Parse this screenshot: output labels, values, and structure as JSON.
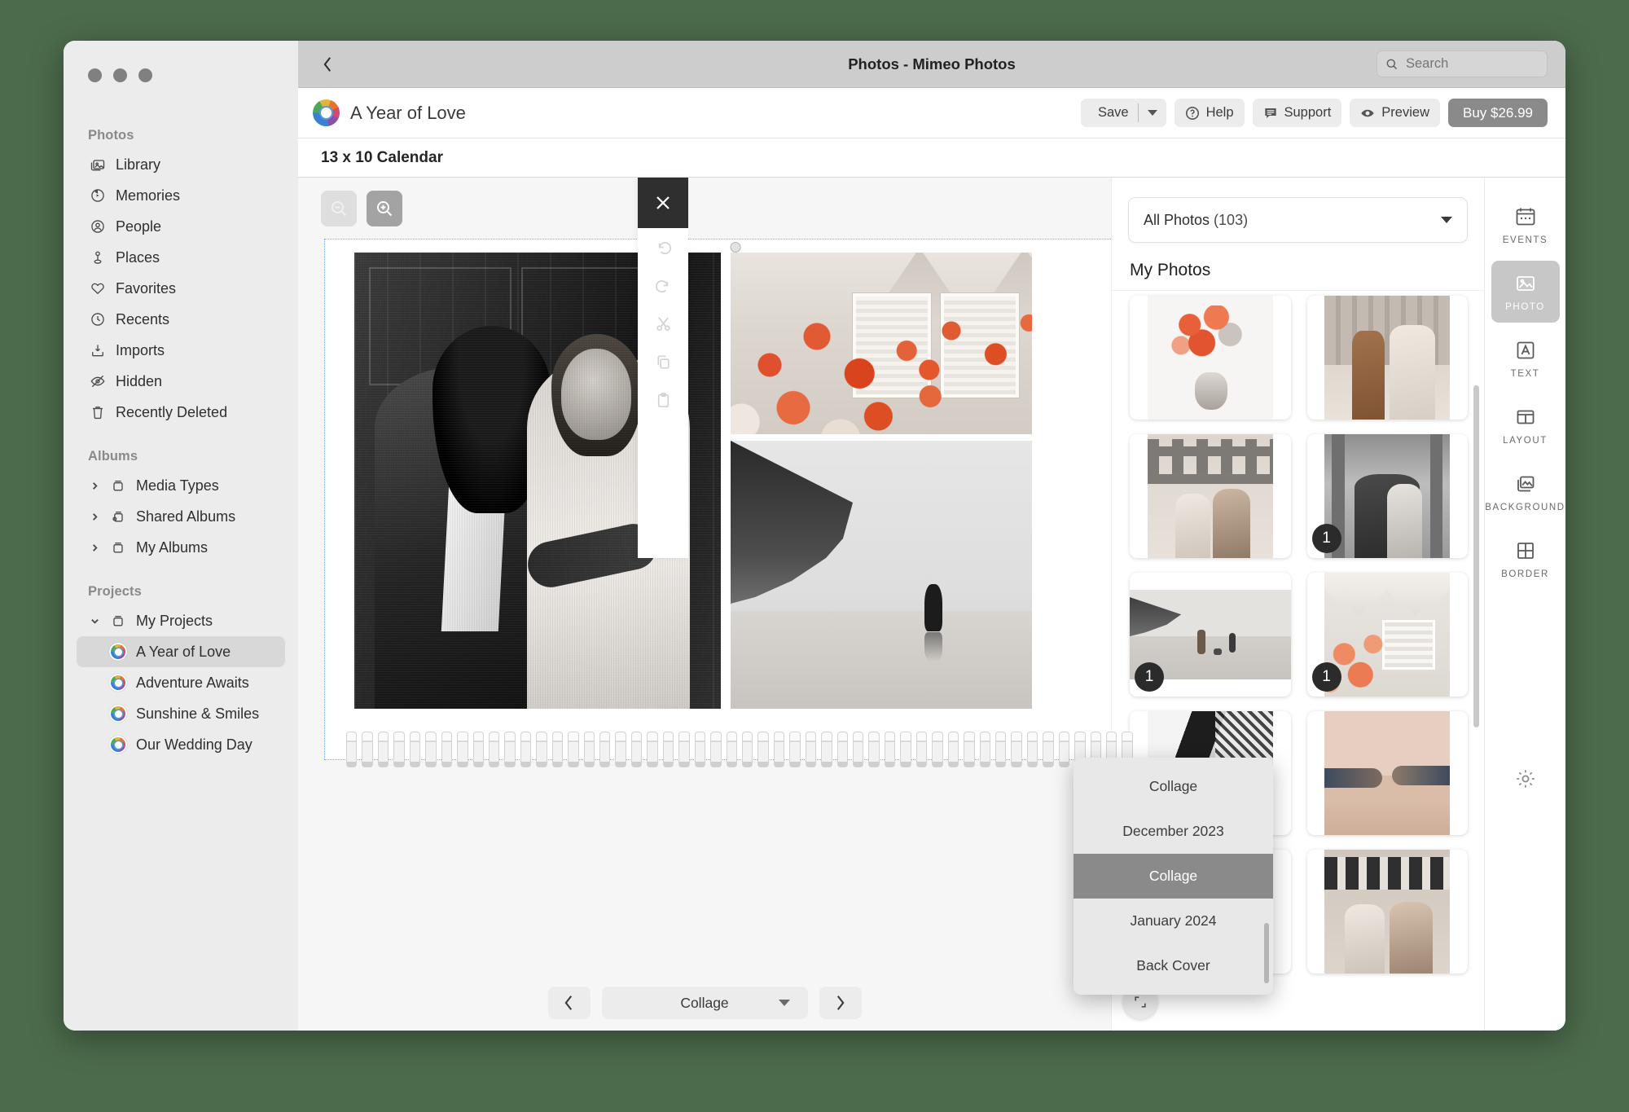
{
  "window": {
    "title": "Photos - Mimeo Photos",
    "back_icon": "chevron-left-icon",
    "search_placeholder": "Search",
    "search_icon": "search-icon"
  },
  "sidebar": {
    "sections": [
      {
        "title": "Photos",
        "items": [
          {
            "label": "Library",
            "icon": "library-icon"
          },
          {
            "label": "Memories",
            "icon": "memories-icon"
          },
          {
            "label": "People",
            "icon": "people-icon"
          },
          {
            "label": "Places",
            "icon": "places-pin-icon"
          },
          {
            "label": "Favorites",
            "icon": "heart-icon"
          },
          {
            "label": "Recents",
            "icon": "clock-icon"
          },
          {
            "label": "Imports",
            "icon": "import-icon"
          },
          {
            "label": "Hidden",
            "icon": "eye-slash-icon"
          },
          {
            "label": "Recently Deleted",
            "icon": "trash-icon"
          }
        ]
      },
      {
        "title": "Albums",
        "items": [
          {
            "label": "Media Types",
            "icon": "album-icon",
            "twisty": "collapsed"
          },
          {
            "label": "Shared Albums",
            "icon": "shared-album-icon",
            "twisty": "collapsed"
          },
          {
            "label": "My Albums",
            "icon": "album-icon",
            "twisty": "collapsed"
          }
        ]
      },
      {
        "title": "Projects",
        "items": [
          {
            "label": "My Projects",
            "icon": "album-icon",
            "twisty": "expanded"
          },
          {
            "label": "A Year of Love",
            "icon": "project-icon",
            "selected": true,
            "indent": true
          },
          {
            "label": "Adventure Awaits",
            "icon": "project-icon",
            "indent": true
          },
          {
            "label": "Sunshine & Smiles",
            "icon": "project-icon",
            "indent": true
          },
          {
            "label": "Our Wedding Day",
            "icon": "project-icon",
            "indent": true
          }
        ]
      }
    ]
  },
  "toolbar": {
    "project_name": "A Year of Love",
    "logo_icon": "mimeo-logo-icon",
    "save_label": "Save",
    "save_icon": "floppy-disk-icon",
    "save_caret_icon": "caret-down-icon",
    "help_label": "Help",
    "help_icon": "question-circle-icon",
    "support_label": "Support",
    "support_icon": "chat-bubble-icon",
    "preview_label": "Preview",
    "preview_icon": "eye-icon",
    "buy_label": "Buy $26.99"
  },
  "subheader": {
    "product": "13 x 10 Calendar"
  },
  "canvas": {
    "zoom_out_icon": "zoom-out-icon",
    "zoom_in_icon": "zoom-in-icon",
    "page_handle": "resize-handle"
  },
  "edit_rail": {
    "close_icon": "close-x-icon",
    "tools": [
      {
        "icon": "undo-icon"
      },
      {
        "icon": "redo-icon"
      },
      {
        "icon": "scissors-cut-icon"
      },
      {
        "icon": "copy-icon"
      },
      {
        "icon": "paste-clipboard-icon"
      }
    ]
  },
  "page_menu": {
    "options": [
      {
        "label": "Collage"
      },
      {
        "label": "December 2023"
      },
      {
        "label": "Collage",
        "selected": true
      },
      {
        "label": "January 2024"
      },
      {
        "label": "Back Cover"
      }
    ]
  },
  "page_nav": {
    "prev_icon": "chevron-left-icon",
    "next_icon": "chevron-right-icon",
    "current_page": "Collage",
    "caret_icon": "caret-down-icon"
  },
  "photos_panel": {
    "filter_label": "All Photos",
    "filter_count": "(103)",
    "filter_caret_icon": "caret-down-icon",
    "heading": "My Photos",
    "expand_icon": "expand-corners-icon",
    "thumbnails": [
      {
        "art": "t-bouquet",
        "orientation": "portrait",
        "badge": null
      },
      {
        "art": "t-couple-balcony",
        "orientation": "portrait",
        "badge": null
      },
      {
        "art": "t-hug-day",
        "orientation": "portrait",
        "badge": null
      },
      {
        "art": "t-elevator",
        "orientation": "portrait",
        "badge": "1"
      },
      {
        "art": "t-beach",
        "orientation": "wide",
        "badge": "1"
      },
      {
        "art": "t-house",
        "orientation": "portrait",
        "badge": "1"
      },
      {
        "art": "t-hands-bw",
        "orientation": "portrait",
        "badge": null
      },
      {
        "art": "t-sunset",
        "orientation": "portrait",
        "badge": null
      },
      {
        "art": "t-portrait-pair",
        "orientation": "portrait",
        "badge": null
      },
      {
        "art": "t-strip",
        "orientation": "portrait",
        "badge": null
      }
    ]
  },
  "tools_rail": {
    "items": [
      {
        "label": "EVENTS",
        "icon": "calendar-icon",
        "active": false
      },
      {
        "label": "PHOTO",
        "icon": "photo-icon",
        "active": true
      },
      {
        "label": "TEXT",
        "icon": "text-a-icon",
        "active": false
      },
      {
        "label": "LAYOUT",
        "icon": "layout-grid-icon",
        "active": false
      },
      {
        "label": "BACKGROUND",
        "icon": "background-layers-icon",
        "active": false
      },
      {
        "label": "BORDER",
        "icon": "border-grid-icon",
        "active": false
      }
    ],
    "settings_icon": "gear-icon"
  },
  "colors": {
    "desktop": "#4c6b4c",
    "sidebar": "#ececec",
    "titlebar": "#cdcdcd",
    "buy_button": "#8a8a8a",
    "menu_selected": "#8a8a8a",
    "edit_close": "#2f2f2f",
    "active_tool": "#c7c7c7"
  }
}
